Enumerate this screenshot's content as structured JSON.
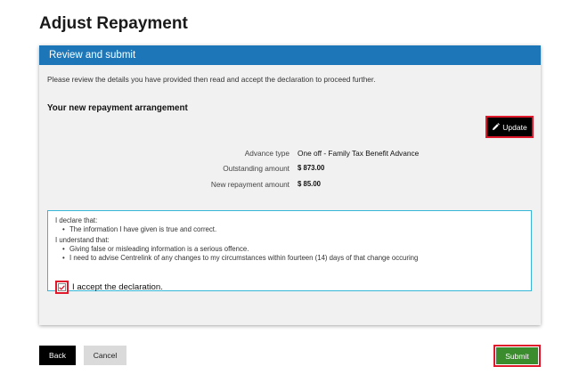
{
  "page": {
    "title": "Adjust Repayment"
  },
  "panel": {
    "header": "Review and submit",
    "intro": "Please review the details you have provided then read and accept the declaration to proceed further.",
    "section_title": "Your new repayment arrangement",
    "update_label": "Update"
  },
  "details": [
    {
      "label": "Advance type",
      "value": "One off - Family Tax Benefit Advance"
    },
    {
      "label": "Outstanding amount",
      "value": "$ 873.00"
    },
    {
      "label": "New repayment amount",
      "value": "$ 85.00"
    }
  ],
  "declaration": {
    "declare_heading": "I declare that:",
    "declare_items": [
      "The information I have given is true and correct."
    ],
    "understand_heading": "I understand that:",
    "understand_items": [
      "Giving false or misleading information is a serious offence.",
      "I need to advise Centrelink of any changes to my circumstances within fourteen (14) days of that change occuring"
    ],
    "accept_label": "I accept the declaration.",
    "accepted": true
  },
  "footer": {
    "back_label": "Back",
    "cancel_label": "Cancel",
    "submit_label": "Submit"
  },
  "colors": {
    "header_blue": "#1c76b8",
    "highlight_red": "#e0182c",
    "submit_green": "#3a8c2c",
    "declaration_border": "#37b6d8"
  },
  "icons": {
    "update": "pencil-icon",
    "accept": "checkmark-icon"
  }
}
